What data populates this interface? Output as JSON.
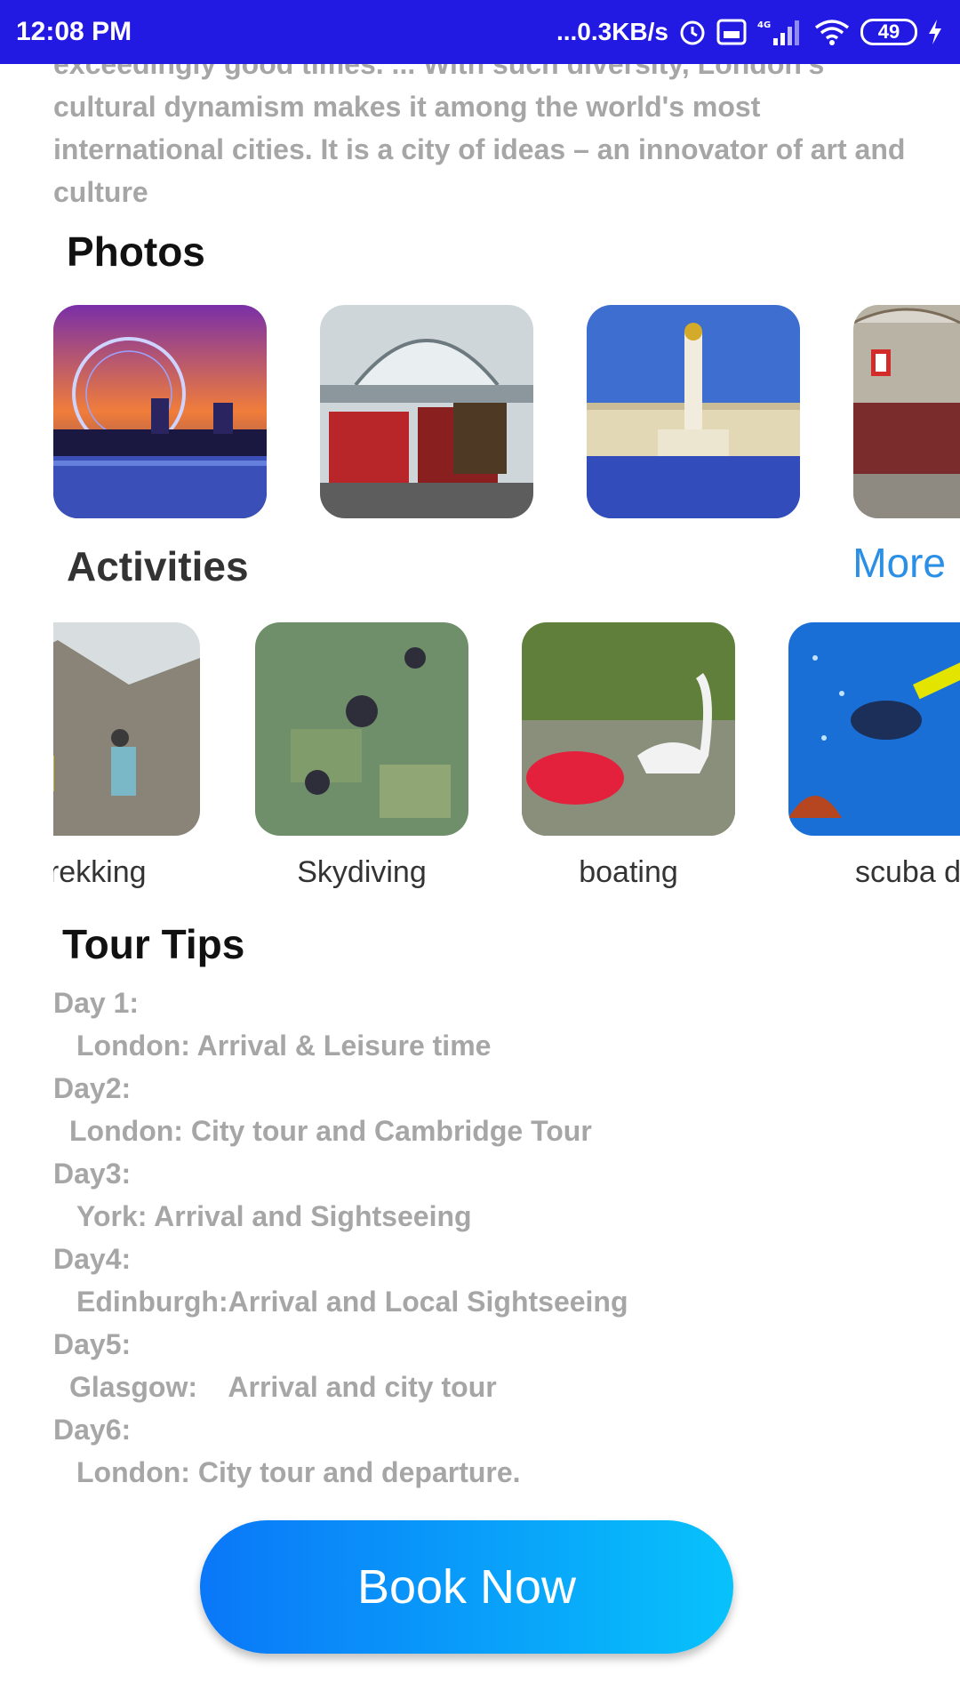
{
  "status_bar": {
    "time": "12:08 PM",
    "network_speed": "...0.3KB/s",
    "battery": "49",
    "icons": [
      "alarm-icon",
      "volte-icon",
      "4g-signal-icon",
      "wifi-icon",
      "battery-icon",
      "charging-icon"
    ]
  },
  "intro": {
    "text": "exceedingly good times. ... With such diversity, London's cultural dynamism makes it among the world's most international cities. It is a city of ideas – an innovator of art and culture"
  },
  "photos": {
    "title": "Photos",
    "items": [
      "london-eye-photo",
      "transport-museum-photo",
      "buckingham-palace-photo",
      "leadenhall-market-photo"
    ]
  },
  "activities": {
    "title": "Activities",
    "more_label": "More",
    "items": [
      {
        "label": "trekking",
        "image": "trekking-image"
      },
      {
        "label": "Skydiving",
        "image": "skydiving-image"
      },
      {
        "label": "boating",
        "image": "boating-image"
      },
      {
        "label": "scuba diving",
        "image": "scuba-image"
      }
    ]
  },
  "tour_tips": {
    "title": "Tour Tips",
    "days": [
      {
        "day": "Day 1:",
        "desc": "London: Arrival & Leisure time"
      },
      {
        "day": "Day2:",
        "desc": "London: City tour and Cambridge Tour"
      },
      {
        "day": "Day3:",
        "desc": "York: Arrival and Sightseeing"
      },
      {
        "day": "Day4:",
        "desc": "Edinburgh:Arrival and Local Sightseeing"
      },
      {
        "day": "Day5:",
        "desc": "Glasgow:    Arrival and city tour"
      },
      {
        "day": "Day6:",
        "desc": "London: City tour and departure."
      }
    ]
  },
  "book_button": {
    "label": "Book Now"
  },
  "colors": {
    "status_bar": "#2219e3",
    "accent_link": "#2b8fe6",
    "button_start": "#0a77f8",
    "button_end": "#08c2fb",
    "muted_text": "#a6a6a6"
  }
}
